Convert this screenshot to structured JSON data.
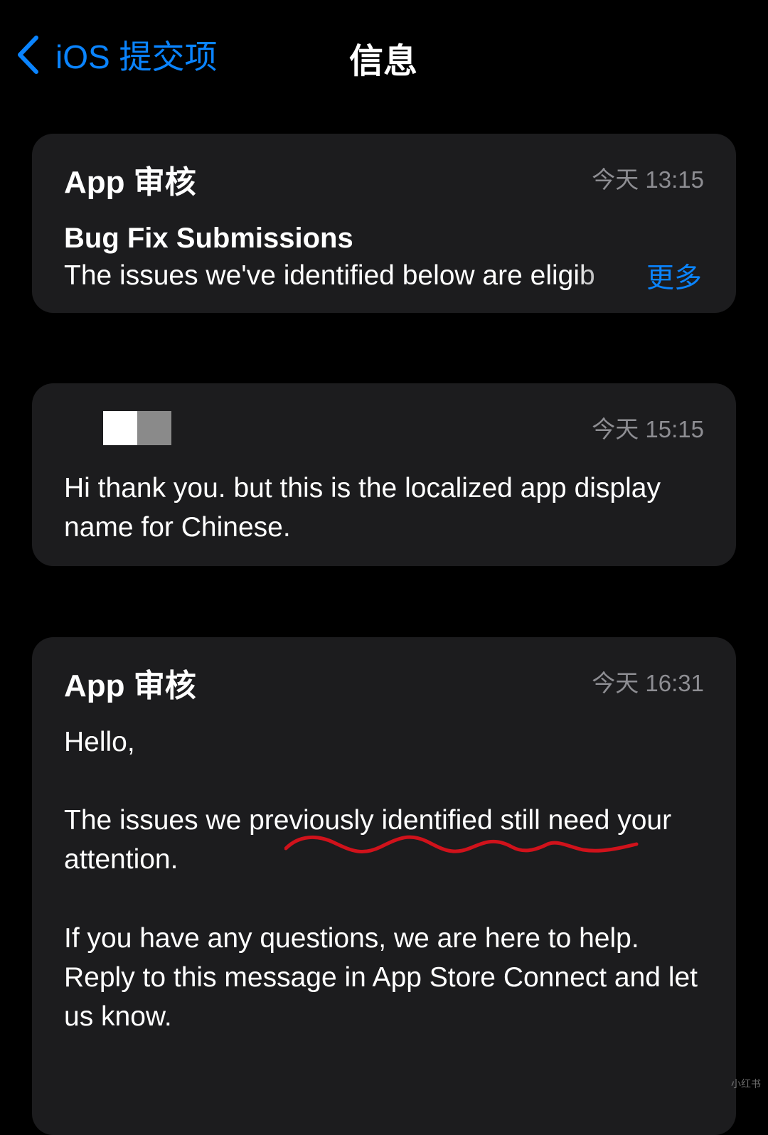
{
  "nav": {
    "back_label": "iOS 提交项",
    "title": "信息"
  },
  "messages": [
    {
      "sender": "App 审核",
      "timestamp": "今天 13:15",
      "subject": "Bug Fix Submissions",
      "preview": "The issues we've identified below are eligib",
      "more_label": "更多"
    },
    {
      "sender_redacted": true,
      "timestamp": "今天 15:15",
      "body": "Hi thank you. but this is the localized app display name for Chinese."
    },
    {
      "sender": "App 审核",
      "timestamp": "今天 16:31",
      "greeting": "Hello,",
      "para_1": "The issues we previously identified still need your attention.",
      "para_2": "If you have any questions, we are here to help. Reply to this message in App Store Connect and let us know."
    }
  ],
  "colors": {
    "background": "#000000",
    "card": "#1c1c1e",
    "accent": "#0a84ff",
    "secondary_text": "#8e8e93",
    "annotation": "#d0121b"
  },
  "icons": {
    "back": "chevron-left-icon"
  },
  "watermark": "小红书"
}
